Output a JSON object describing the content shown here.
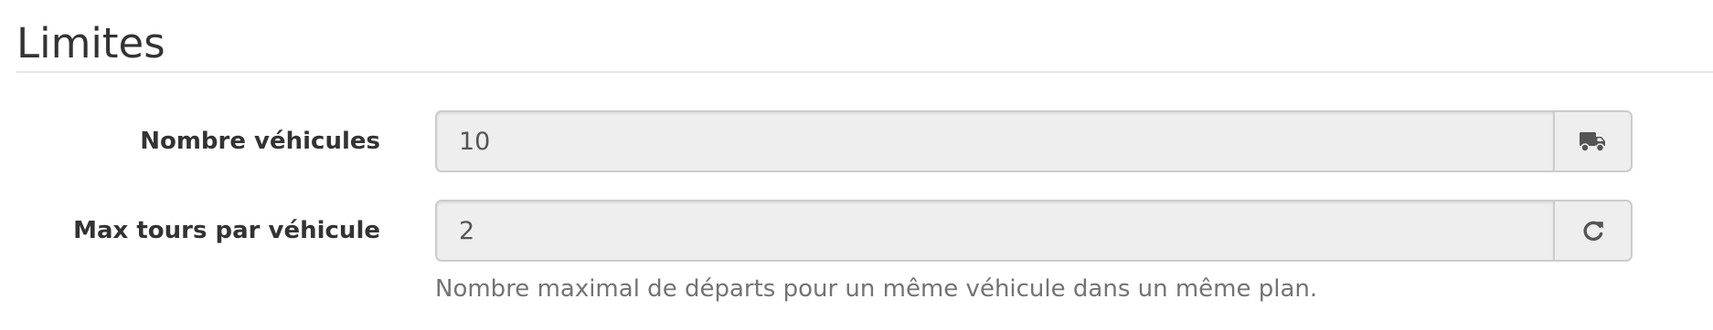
{
  "section": {
    "title": "Limites"
  },
  "fields": {
    "vehicles": {
      "label": "Nombre véhicules",
      "value": "10",
      "icon": "truck-icon"
    },
    "tours": {
      "label": "Max tours par véhicule",
      "value": "2",
      "icon": "refresh-icon",
      "help": "Nombre maximal de départs pour un même véhicule dans un même plan."
    }
  },
  "colors": {
    "input_background": "#eeeeee",
    "input_border": "#cccccc",
    "text": "#333333",
    "help_text": "#737373"
  }
}
